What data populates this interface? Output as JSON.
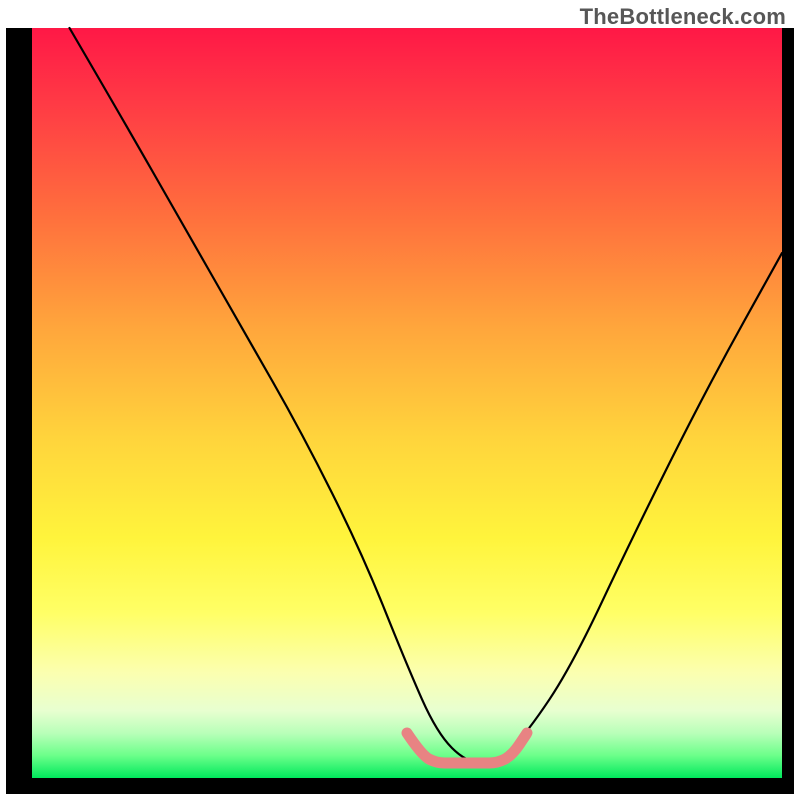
{
  "watermark": "TheBottleneck.com",
  "chart_data": {
    "type": "line",
    "title": "",
    "xlabel": "",
    "ylabel": "",
    "xlim": [
      0,
      100
    ],
    "ylim": [
      0,
      100
    ],
    "series": [
      {
        "name": "black-curve",
        "color": "#000000",
        "x": [
          5,
          12,
          20,
          28,
          36,
          44,
          50,
          54,
          58,
          62,
          66,
          72,
          80,
          90,
          100
        ],
        "y": [
          100,
          88,
          74,
          60,
          46,
          30,
          15,
          6,
          2,
          2,
          6,
          15,
          32,
          52,
          70
        ]
      },
      {
        "name": "pink-trough",
        "color": "#e88383",
        "x": [
          50,
          52,
          54,
          56,
          58,
          60,
          62,
          64,
          66
        ],
        "y": [
          6,
          3,
          2,
          2,
          2,
          2,
          2,
          3,
          6
        ]
      }
    ],
    "gradient_stops": [
      {
        "pos": 0,
        "color": "#ff1846"
      },
      {
        "pos": 25,
        "color": "#ff6f3d"
      },
      {
        "pos": 55,
        "color": "#ffd53c"
      },
      {
        "pos": 78,
        "color": "#ffff66"
      },
      {
        "pos": 94,
        "color": "#b9ffb9"
      },
      {
        "pos": 100,
        "color": "#00e85c"
      }
    ]
  }
}
